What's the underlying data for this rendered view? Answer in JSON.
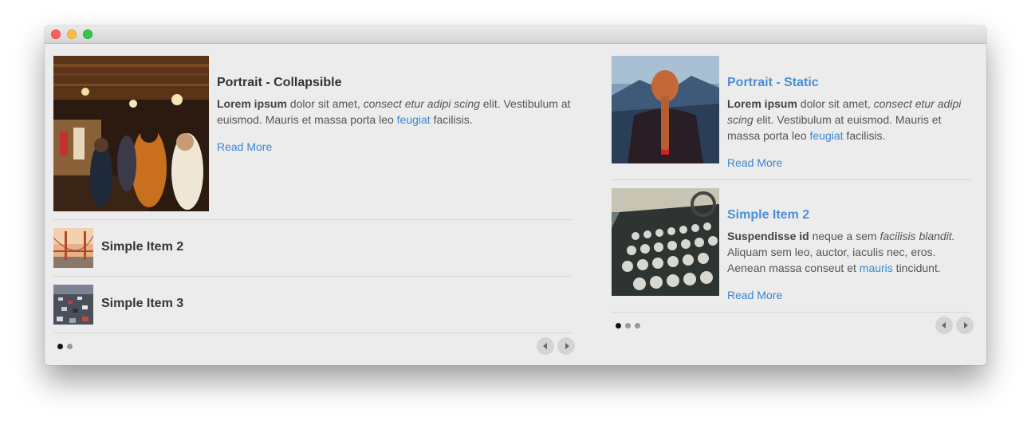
{
  "left": {
    "featured": {
      "title": "Portrait - Collapsible",
      "desc_bold": "Lorem ipsum",
      "desc_t1": " dolor sit amet, ",
      "desc_italic": "consect etur adipi scing",
      "desc_t2": " elit. Vestibulum at euismod. Mauris et massa porta leo ",
      "desc_link": "feugiat",
      "desc_t3": " facilisis.",
      "read_more": "Read More"
    },
    "items": [
      {
        "title": "Simple Item 2"
      },
      {
        "title": "Simple Item 3"
      }
    ],
    "pager": {
      "pages": 2,
      "active": 1
    }
  },
  "right": {
    "item1": {
      "title": "Portrait - Static",
      "desc_bold": "Lorem ipsum",
      "desc_t1": " dolor sit amet, ",
      "desc_italic": "consect etur adipi scing",
      "desc_t2": " elit. Vestibulum at euismod. Mauris et massa porta leo ",
      "desc_link": "feugiat",
      "desc_t3": " facilisis.",
      "read_more": "Read More"
    },
    "item2": {
      "title": "Simple Item 2",
      "desc_bold": "Suspendisse id",
      "desc_t1": " neque a sem ",
      "desc_italic": "facilisis blandit.",
      "desc_t2": " Aliquam sem leo, auctor, iaculis nec, eros. Aenean massa conseut et ",
      "desc_link": "mauris",
      "desc_t3": " tincidunt.",
      "read_more": "Read More"
    },
    "pager": {
      "pages": 3,
      "active": 1
    }
  },
  "colors": {
    "link": "#3c86d1",
    "title_link": "#4a8fd4",
    "window_bg": "#ececec"
  }
}
